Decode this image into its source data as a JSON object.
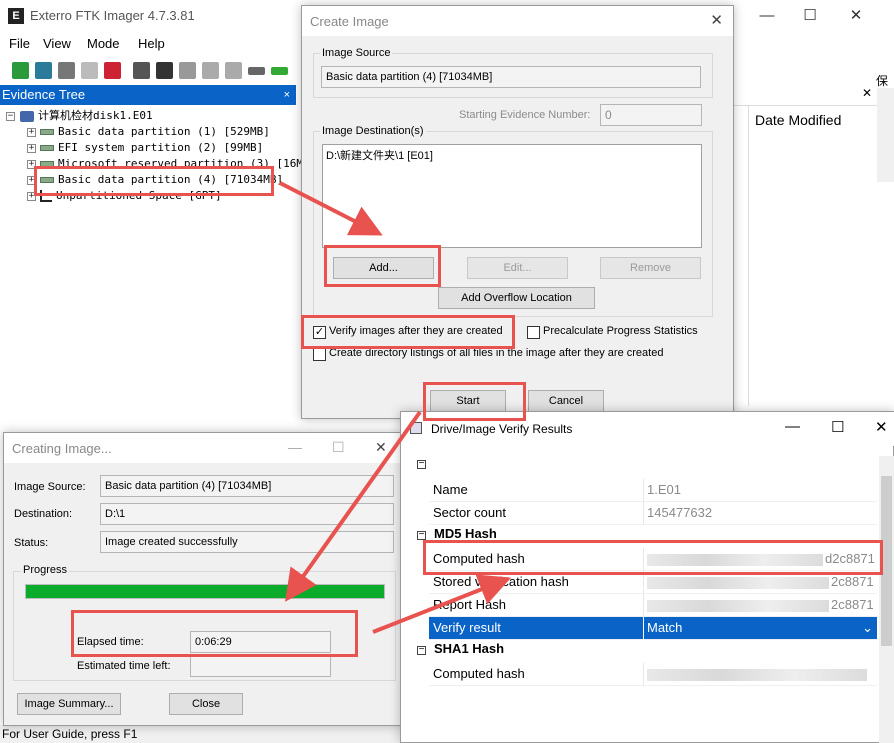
{
  "main_window": {
    "title": "Exterro FTK Imager 4.7.3.81",
    "menu": [
      "File",
      "View",
      "Mode",
      "Help"
    ],
    "evidence_tree_title": "Evidence Tree",
    "evidence_tree_pin": "×",
    "tree": {
      "root": "计算机检材disk1.E01",
      "items": [
        "Basic data partition (1) [529MB]",
        "EFI system partition (2) [99MB]",
        "Microsoft reserved partition (3) [16MB]",
        "Basic data partition (4) [71034MB]",
        "Unpartitioned Space [GPT]"
      ]
    },
    "right_pane_column": "Date Modified",
    "right_edge_text": "保",
    "status_bar": "For User Guide, press F1"
  },
  "create_image": {
    "title": "Create Image",
    "image_source_label": "Image Source",
    "image_source_value": "Basic data partition (4) [71034MB]",
    "starting_evidence_label": "Starting Evidence Number:",
    "starting_evidence_value": "0",
    "image_destinations_label": "Image Destination(s)",
    "destinations": [
      "D:\\新建文件夹\\1 [E01]"
    ],
    "add_label": "Add...",
    "edit_label": "Edit...",
    "remove_label": "Remove",
    "add_overflow_label": "Add Overflow Location",
    "verify_label": "Verify images after they are created",
    "verify_checked": true,
    "precalc_label": "Precalculate Progress Statistics",
    "precalc_checked": false,
    "dir_listing_label": "Create directory listings of all files in the image after they are created",
    "dir_listing_checked": false,
    "start_label": "Start",
    "cancel_label": "Cancel"
  },
  "creating_image": {
    "title": "Creating Image...",
    "image_source_label": "Image Source:",
    "image_source_value": "Basic data partition (4) [71034MB]",
    "destination_label": "Destination:",
    "destination_value": "D:\\1",
    "status_label": "Status:",
    "status_value": "Image created successfully",
    "progress_label": "Progress",
    "progress_fraction": 1.0,
    "elapsed_label": "Elapsed time:",
    "elapsed_value": "0:06:29",
    "estimated_label": "Estimated time left:",
    "estimated_value": "",
    "image_summary_label": "Image Summary...",
    "close_label": "Close"
  },
  "verify_results": {
    "title": "Drive/Image Verify Results",
    "rows_general": [
      {
        "key": "Name",
        "value": "1.E01"
      },
      {
        "key": "Sector count",
        "value": "145477632"
      }
    ],
    "md5_category": "MD5 Hash",
    "md5_rows": [
      {
        "key": "Computed hash",
        "value": "d2c8871"
      },
      {
        "key": "Stored verification hash",
        "value": "2c8871"
      },
      {
        "key": "Report Hash",
        "value": "2c8871"
      },
      {
        "key": "Verify result",
        "value": "Match"
      }
    ],
    "sha1_category": "SHA1 Hash",
    "sha1_rows": [
      {
        "key": "Computed hash",
        "value": ""
      }
    ],
    "colors": {
      "selection": "#0a64c8",
      "annotation": "#e8524f",
      "progress": "#0bab2b"
    }
  }
}
